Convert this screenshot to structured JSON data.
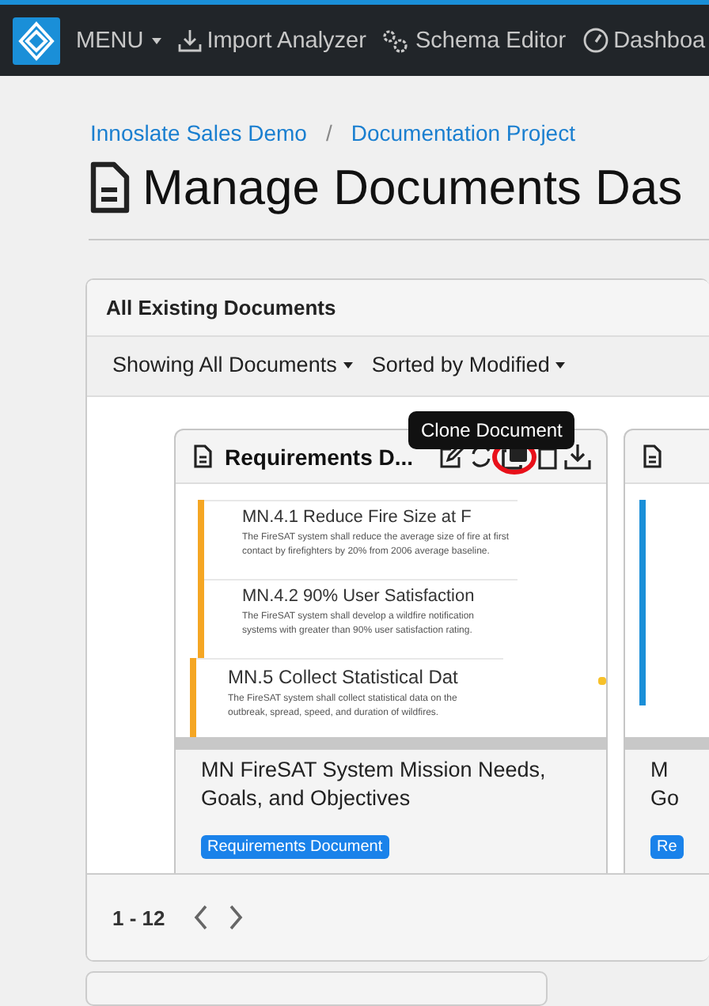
{
  "navbar": {
    "menu": "MENU",
    "items": [
      {
        "label": "Import Analyzer"
      },
      {
        "label": "Schema Editor"
      },
      {
        "label": "Dashboa"
      }
    ]
  },
  "breadcrumb": [
    "Innoslate Sales Demo",
    "Documentation Project"
  ],
  "breadcrumb_separator": "/",
  "page_title": "Manage Documents Das",
  "panel": {
    "title": "All Existing Documents",
    "filters": [
      "Showing All Documents",
      "Sorted by Modified"
    ]
  },
  "tooltip": "Clone Document",
  "cards": [
    {
      "title": "Requirements D...",
      "color": "#f5a623",
      "preview": [
        {
          "kind": "sub",
          "heading": "MN.4.1 Reduce Fire Size at F",
          "text": "The FireSAT system shall reduce the average size of fire at first contact by firefighters by 20% from 2006 average baseline."
        },
        {
          "kind": "sub",
          "heading": "MN.4.2 90% User Satisfaction",
          "text": "The FireSAT system shall develop a wildfire notification systems with greater than 90% user satisfaction rating."
        },
        {
          "kind": "top",
          "heading": "MN.5 Collect Statistical Dat",
          "text": "The FireSAT system shall collect statistical data on the outbreak, spread, speed, and duration of wildfires."
        }
      ],
      "name_lines": [
        "MN FireSAT System Mission Needs,",
        "Goals, and Objectives"
      ],
      "badge": "Requirements Document"
    },
    {
      "color": "#1a8fd8",
      "name_lines": [
        "M",
        "Go"
      ],
      "badge": "Re"
    }
  ],
  "pagination": {
    "range": "1 - 12"
  }
}
